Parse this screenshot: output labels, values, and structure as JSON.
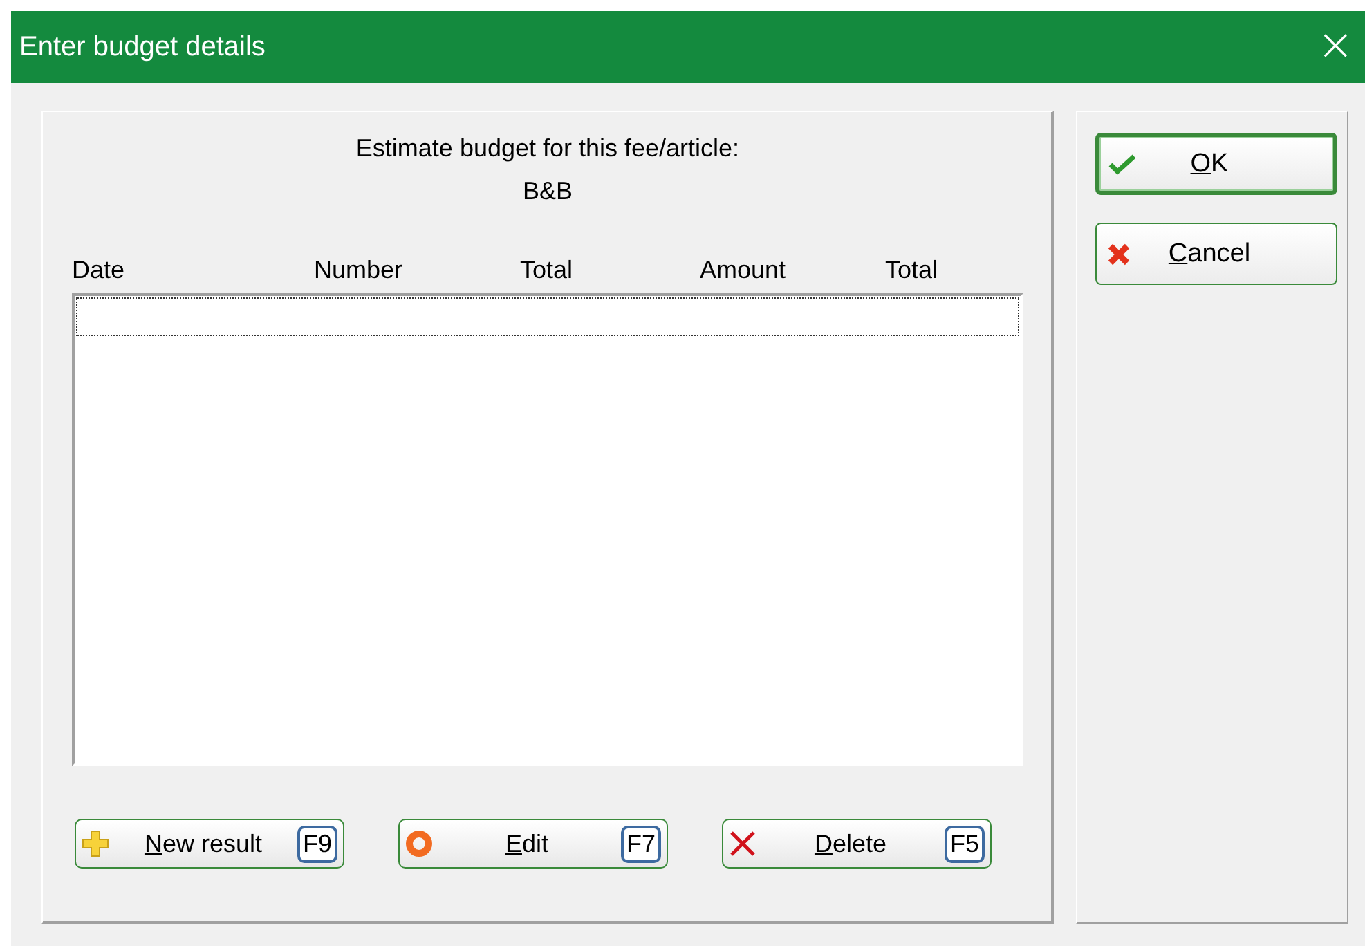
{
  "window": {
    "title": "Enter budget details",
    "close": "×"
  },
  "prompt": "Estimate budget for this fee/article:",
  "article": "B&B",
  "table": {
    "columns": [
      "Date",
      "Number",
      "Total",
      "Amount",
      "Total"
    ],
    "focus_row": true
  },
  "actions": [
    {
      "kind": "plus",
      "label": "New result",
      "mnemonic_underlined": true,
      "shortcut": "F9"
    },
    {
      "kind": "ring",
      "label": "Edit",
      "mnemonic_underlined": true,
      "shortcut": "F7"
    },
    {
      "kind": "cross",
      "label": "Delete",
      "mnemonic_underlined": true,
      "shortcut": "F5"
    }
  ],
  "dialog_buttons": [
    {
      "kind": "check",
      "label": "OK",
      "mnemonic_underlined": true,
      "default": true
    },
    {
      "kind": "cancel",
      "label": "Cancel",
      "mnemonic_underlined": true,
      "default": false
    }
  ]
}
